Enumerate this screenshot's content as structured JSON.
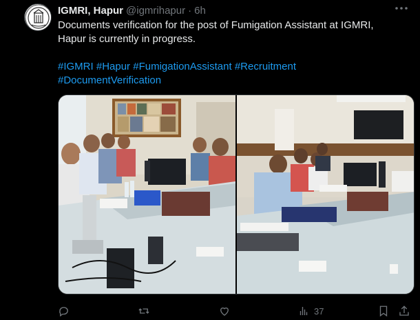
{
  "author": {
    "display_name": "IGMRI, Hapur",
    "handle": "@igmrihapur",
    "separator": "·",
    "time": "6h",
    "avatar_icon": "igmri-logo-icon"
  },
  "tweet": {
    "text": "Documents verification for the post of Fumigation Assistant at IGMRI, Hapur is currently in progress.",
    "hashtags": [
      "#IGMRI",
      "#Hapur",
      "#FumigationAssistant",
      "#Recruitment",
      "#DocumentVerification"
    ]
  },
  "media": {
    "count": 2,
    "photo_left_icon": "meeting-room-photo",
    "photo_right_icon": "document-verification-photo"
  },
  "actions": {
    "reply_icon": "reply-icon",
    "retweet_icon": "retweet-icon",
    "like_icon": "heart-icon",
    "views_icon": "views-chart-icon",
    "views_count": "37",
    "bookmark_icon": "bookmark-icon",
    "share_icon": "share-icon",
    "more_icon": "more-dots-icon"
  },
  "colors": {
    "background": "#000000",
    "text": "#e7e9ea",
    "muted": "#71767b",
    "link": "#1d9bf0"
  }
}
